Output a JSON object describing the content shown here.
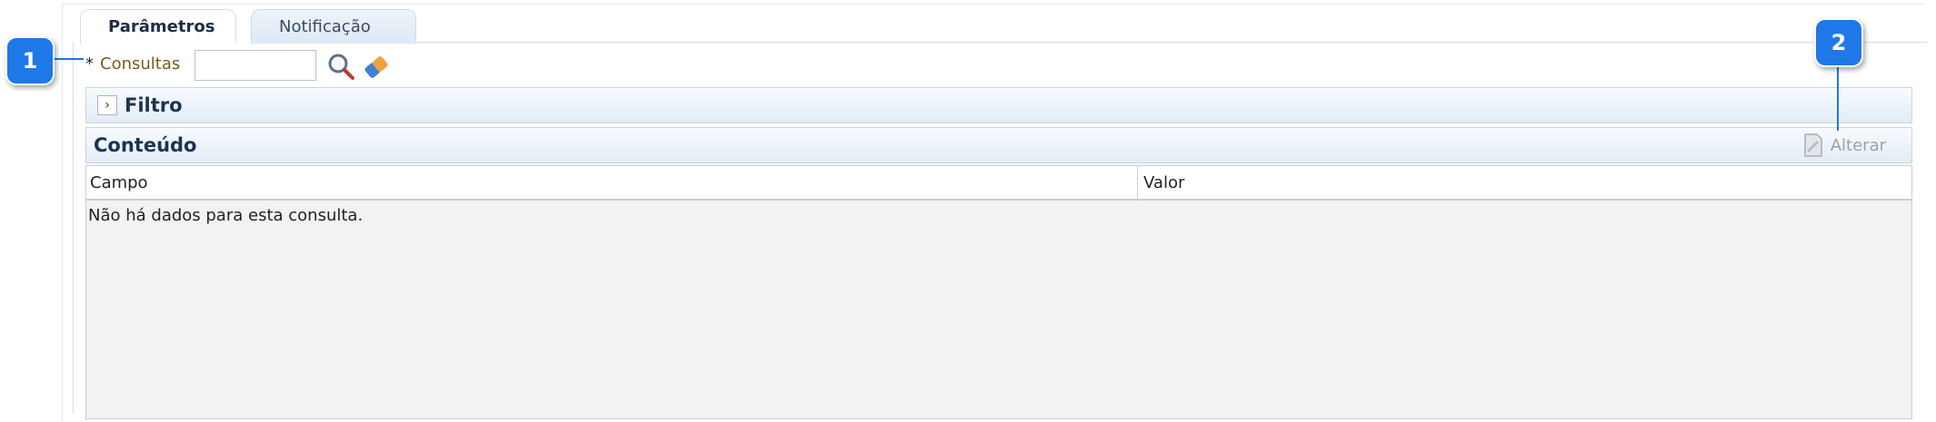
{
  "tabs": [
    {
      "label": "Parâmetros",
      "active": true
    },
    {
      "label": "Notificação",
      "active": false
    }
  ],
  "consultas": {
    "required_marker": "*",
    "label": "Consultas",
    "value": ""
  },
  "panels": {
    "filtro": {
      "title": "Filtro",
      "expand_glyph": "›"
    },
    "conteudo": {
      "title": "Conteúdo",
      "action": "Alterar"
    }
  },
  "table": {
    "columns": [
      "Campo",
      "Valor"
    ],
    "empty_message": "Não há dados para esta consulta."
  },
  "callouts": [
    "1",
    "2"
  ],
  "colors": {
    "callout": "#1f78e8",
    "panel_title": "#1c3352",
    "label": "#7a5a1e"
  },
  "icons": {
    "search": "search-icon",
    "clear": "eraser-icon",
    "edit": "document-icon",
    "expand": "chevron-right-icon"
  }
}
